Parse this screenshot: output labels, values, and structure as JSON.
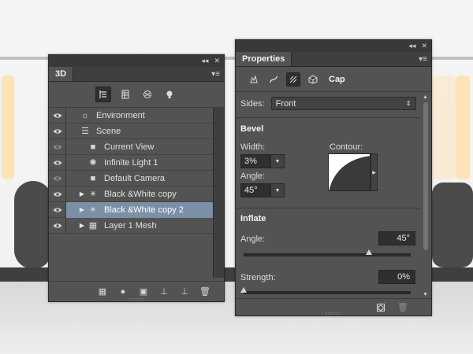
{
  "panel_3d": {
    "tab_label": "3D",
    "window_buttons": {
      "collapse": "◂◂",
      "close": "✕"
    },
    "panel_menu": "▾≡",
    "filter_icons": [
      "scene-filter-icon",
      "mesh-filter-icon",
      "material-filter-icon",
      "light-filter-icon"
    ],
    "rows": [
      {
        "label": "Environment",
        "icon": "☼",
        "visible": true,
        "twirl": "",
        "indent": 0,
        "selected": false
      },
      {
        "label": "Scene",
        "icon": "☰",
        "visible": true,
        "twirl": "",
        "indent": 0,
        "selected": false
      },
      {
        "label": "Current View",
        "icon": "■",
        "visible": false,
        "twirl": "",
        "indent": 1,
        "selected": false
      },
      {
        "label": "Infinite Light 1",
        "icon": "✺",
        "visible": true,
        "twirl": "",
        "indent": 1,
        "selected": false
      },
      {
        "label": "Default Camera",
        "icon": "■",
        "visible": false,
        "twirl": "",
        "indent": 1,
        "selected": false
      },
      {
        "label": "Black &White copy",
        "icon": "⚹",
        "visible": true,
        "twirl": "▶",
        "indent": 1,
        "selected": false
      },
      {
        "label": "Black &White copy 2",
        "icon": "⚹",
        "visible": true,
        "twirl": "▶",
        "indent": 1,
        "selected": true
      },
      {
        "label": "Layer 1 Mesh",
        "icon": "▦",
        "visible": true,
        "twirl": "▶",
        "indent": 1,
        "selected": false
      }
    ],
    "bottom_icons": [
      "▦",
      "●",
      "▣",
      "⊥",
      "⊥",
      "🗑"
    ]
  },
  "properties": {
    "tab_label": "Properties",
    "window_buttons": {
      "collapse": "◂◂",
      "close": "✕"
    },
    "panel_menu": "▾≡",
    "mode_label": "Cap",
    "sides_label": "Sides:",
    "sides_value": "Front",
    "bevel": {
      "title": "Bevel",
      "width_label": "Width:",
      "width_value": "3%",
      "angle_label": "Angle:",
      "angle_value": "45°",
      "contour_label": "Contour:"
    },
    "inflate": {
      "title": "Inflate",
      "angle_label": "Angle:",
      "angle_value": "45°",
      "angle_level": 0.75,
      "strength_label": "Strength:",
      "strength_value": "0%",
      "strength_level": 0.0
    }
  },
  "colors": {
    "panel": "#535353",
    "selection": "#7b8fa6",
    "bulge": "#fde3b6"
  }
}
